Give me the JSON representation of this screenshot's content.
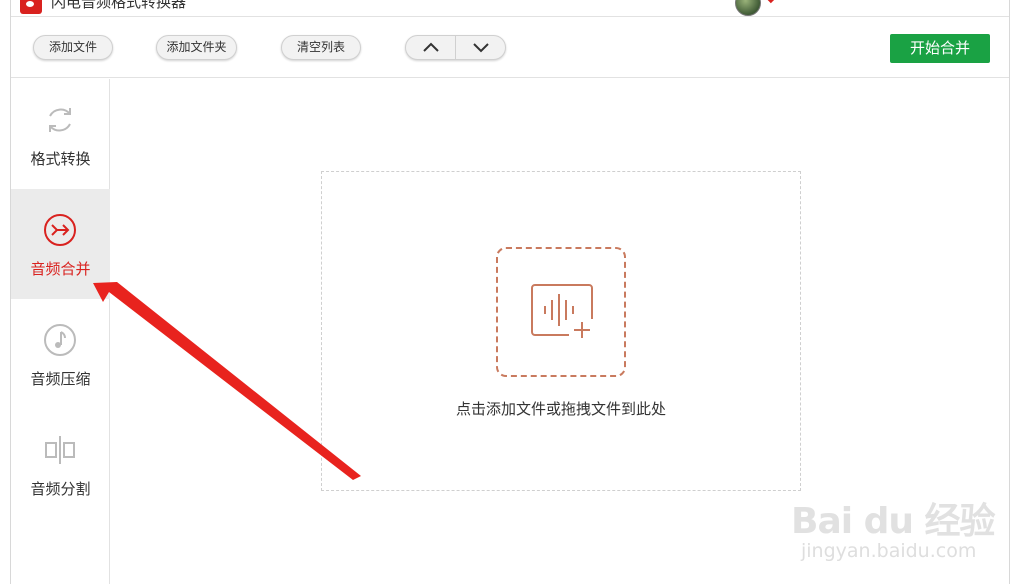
{
  "window": {
    "title": "闪电音频格式转换器"
  },
  "toolbar": {
    "add_file": "添加文件",
    "add_folder": "添加文件夹",
    "clear_list": "清空列表",
    "start_merge": "开始合并",
    "start_color": "#1aa244"
  },
  "sidebar": {
    "items": [
      {
        "label": "格式转换",
        "icon": "refresh-icon",
        "active": false
      },
      {
        "label": "音频合并",
        "icon": "merge-arrow-icon",
        "active": true
      },
      {
        "label": "音频压缩",
        "icon": "music-note-icon",
        "active": false
      },
      {
        "label": "音频分割",
        "icon": "split-icon",
        "active": false
      }
    ],
    "active_color": "#d9221f"
  },
  "dropzone": {
    "hint": "点击添加文件或拖拽文件到此处",
    "icon": "audio-add-icon",
    "accent": "#c97a5e"
  },
  "watermark": {
    "logo": "Bai du 经验",
    "url": "jingyan.baidu.com"
  }
}
